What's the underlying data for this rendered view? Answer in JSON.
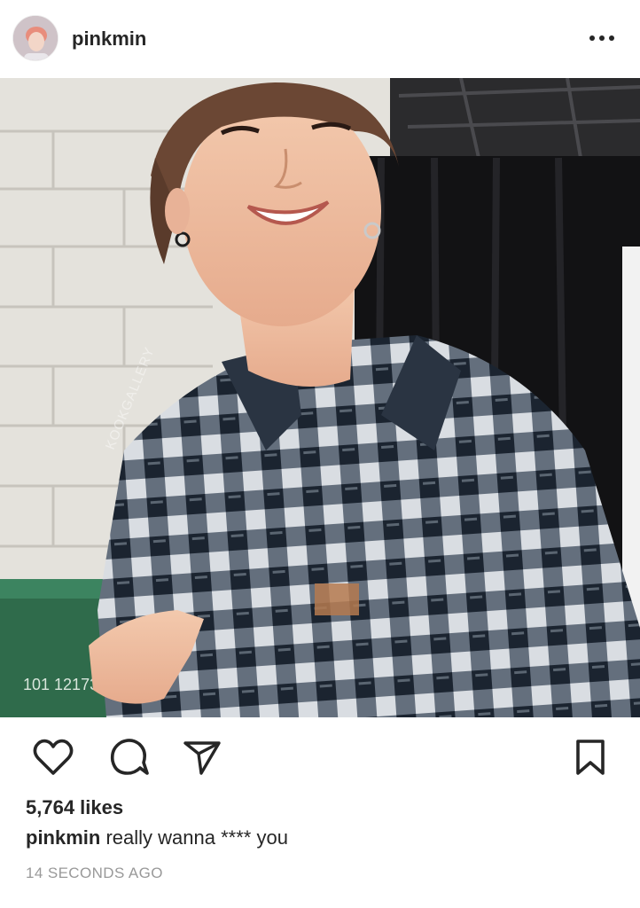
{
  "header": {
    "username": "pinkmin",
    "avatar_icon": "profile-avatar",
    "more_icon": "more-options-icon"
  },
  "photo": {
    "watermark": "KOOKGALLERY",
    "bin_label": "101 12173"
  },
  "actions": {
    "icons": [
      "heart-icon",
      "comment-icon",
      "share-icon",
      "bookmark-icon"
    ]
  },
  "post": {
    "likes": "5,764 likes",
    "caption_user": "pinkmin",
    "caption_text": "really wanna **** you",
    "timestamp": "14 SECONDS AGO"
  },
  "colors": {
    "text": "#262626",
    "muted": "#999999",
    "background": "#ffffff"
  }
}
